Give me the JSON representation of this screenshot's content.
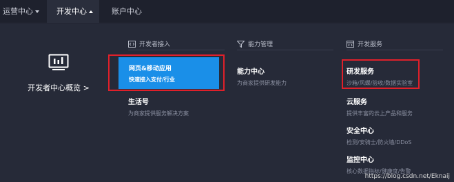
{
  "topnav": {
    "tabs": [
      {
        "label": "运营中心",
        "caret": "down"
      },
      {
        "label": "开发中心",
        "caret": "up"
      },
      {
        "label": "账户中心"
      }
    ]
  },
  "overview": {
    "label": "开发者中心概览 >",
    "icon": "monitor-chart-icon"
  },
  "sections": {
    "developer_access": {
      "title": "开发者接入",
      "icon": "code-icon",
      "items": [
        {
          "title": "网页&移动应用",
          "desc": "快速接入支付/行业"
        },
        {
          "title": "生活号",
          "desc": "为商家提供服务解决方案"
        }
      ]
    },
    "capability": {
      "title": "能力管理",
      "icon": "funnel-icon",
      "items": [
        {
          "title": "能力中心",
          "desc": "为商家提供研发能力"
        }
      ]
    },
    "dev_services": {
      "title": "开发服务",
      "icon": "code-window-icon",
      "items": [
        {
          "title": "研发服务",
          "desc": "沙箱/风蝶/验收/数据实验室"
        },
        {
          "title": "云服务",
          "desc": "提供丰富的云上产品和服务"
        },
        {
          "title": "安全中心",
          "desc": "检测/安骑士/防火墙/DDoS"
        },
        {
          "title": "监控中心",
          "desc": "核心数据指标/健康度/告警"
        }
      ]
    }
  },
  "watermark": "https://blog.csdn.net/Eknaij",
  "colors": {
    "highlight": "#1a8fe8",
    "annotation": "#e0202a",
    "background": "#262a38"
  }
}
